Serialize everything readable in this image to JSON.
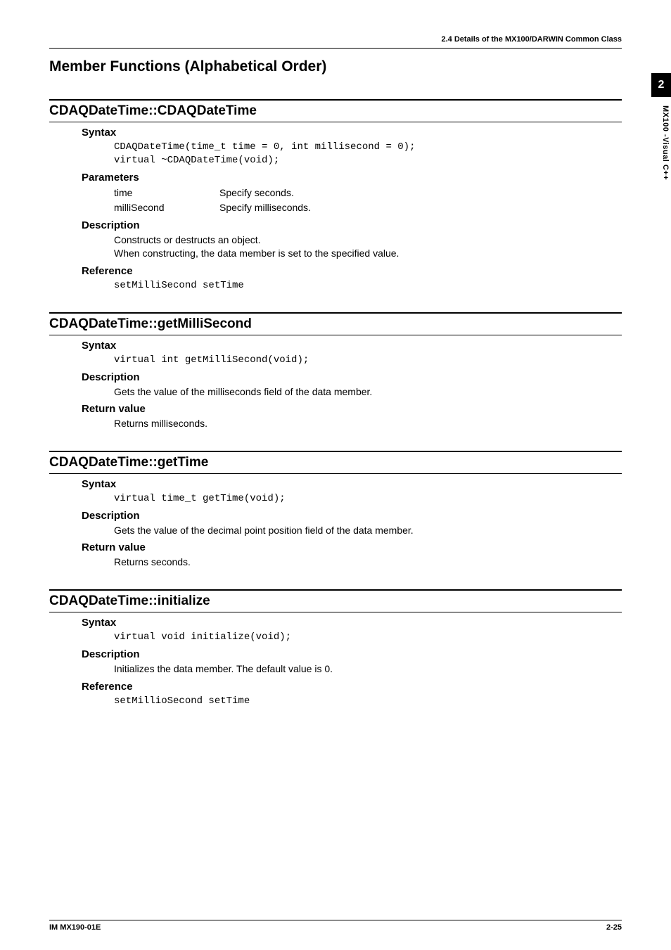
{
  "runningHead": "2.4  Details of the MX100/DARWIN Common Class",
  "pageTitle": "Member Functions (Alphabetical Order)",
  "sideTab": {
    "number": "2",
    "label": "MX100 -Visual C++"
  },
  "footer": {
    "left": "IM MX190-01E",
    "right": "2-25"
  },
  "labels": {
    "syntax": "Syntax",
    "parameters": "Parameters",
    "description": "Description",
    "reference": "Reference",
    "returnValue": "Return value"
  },
  "sections": [
    {
      "title": "CDAQDateTime::CDAQDateTime",
      "syntax": "CDAQDateTime(time_t time = 0, int millisecond = 0);\nvirtual ~CDAQDateTime(void);",
      "parameters": [
        {
          "name": "time",
          "desc": "Specify seconds."
        },
        {
          "name": "milliSecond",
          "desc": "Specify milliseconds."
        }
      ],
      "description": [
        "Constructs or destructs an object.",
        "When constructing, the data member is set to the specified value."
      ],
      "reference": "setMilliSecond setTime"
    },
    {
      "title": "CDAQDateTime::getMilliSecond",
      "syntax": "virtual int getMilliSecond(void);",
      "description": [
        "Gets the value of the milliseconds field of the data member."
      ],
      "returnValue": "Returns milliseconds."
    },
    {
      "title": "CDAQDateTime::getTime",
      "syntax": "virtual time_t getTime(void);",
      "description": [
        "Gets the value of the decimal point position field of the data member."
      ],
      "returnValue": "Returns seconds."
    },
    {
      "title": "CDAQDateTime::initialize",
      "syntax": "virtual void initialize(void);",
      "description": [
        "Initializes the data member. The default value is 0."
      ],
      "reference": "setMillioSecond setTime"
    }
  ]
}
